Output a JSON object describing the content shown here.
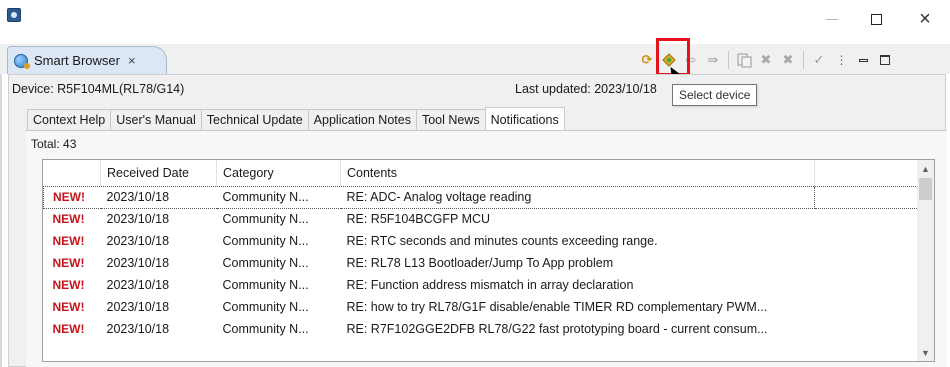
{
  "window": {
    "icon": "eclipse-app-icon",
    "minimize_icon": "minimize-icon",
    "maximize_icon": "maximize-icon",
    "close_glyph": "×"
  },
  "view": {
    "tab_label": "Smart Browser",
    "tab_close": "×",
    "tab_icon": "globe-icon"
  },
  "toolbar": {
    "icons": [
      "refresh-icon",
      "select-device-icon",
      "arrow-right-icon",
      "arrow-double-right-icon",
      "document-icon",
      "delete-icon",
      "delete-all-icon",
      "checkmark-icon",
      "view-menu-icon",
      "view-minimize-icon",
      "view-maximize-icon"
    ],
    "tooltip": "Select device",
    "highlight_color": "#e4121a"
  },
  "device_line": "Device: R5F104ML(RL78/G14)",
  "updated_line": "Last updated: 2023/10/18",
  "tabs": [
    {
      "label": "Context Help",
      "active": false
    },
    {
      "label": "User's Manual",
      "active": false
    },
    {
      "label": "Technical Update",
      "active": false
    },
    {
      "label": "Application Notes",
      "active": false
    },
    {
      "label": "Tool News",
      "active": false
    },
    {
      "label": "Notifications",
      "active": true
    }
  ],
  "total_line": "Total: 43",
  "table": {
    "headers": [
      "",
      "Received Date",
      "Category",
      "Contents",
      ""
    ],
    "rows": [
      {
        "badge": "NEW!",
        "date": "2023/10/18",
        "category": "Community N...",
        "contents": "RE: ADC- Analog voltage reading"
      },
      {
        "badge": "NEW!",
        "date": "2023/10/18",
        "category": "Community N...",
        "contents": "RE: R5F104BCGFP MCU"
      },
      {
        "badge": "NEW!",
        "date": "2023/10/18",
        "category": "Community N...",
        "contents": "RE: RTC seconds and minutes counts exceeding range."
      },
      {
        "badge": "NEW!",
        "date": "2023/10/18",
        "category": "Community N...",
        "contents": "RE: RL78 L13 Bootloader/Jump To App problem"
      },
      {
        "badge": "NEW!",
        "date": "2023/10/18",
        "category": "Community N...",
        "contents": "RE: Function address mismatch in array declaration"
      },
      {
        "badge": "NEW!",
        "date": "2023/10/18",
        "category": "Community N...",
        "contents": "RE: how to try RL78/G1F disable/enable TIMER RD complementary PWM..."
      },
      {
        "badge": "NEW!",
        "date": "2023/10/18",
        "category": "Community N...",
        "contents": "RE: R7F102GGE2DFB RL78/G22 fast prototyping board - current consum..."
      }
    ],
    "badge_color": "#c4151c"
  }
}
